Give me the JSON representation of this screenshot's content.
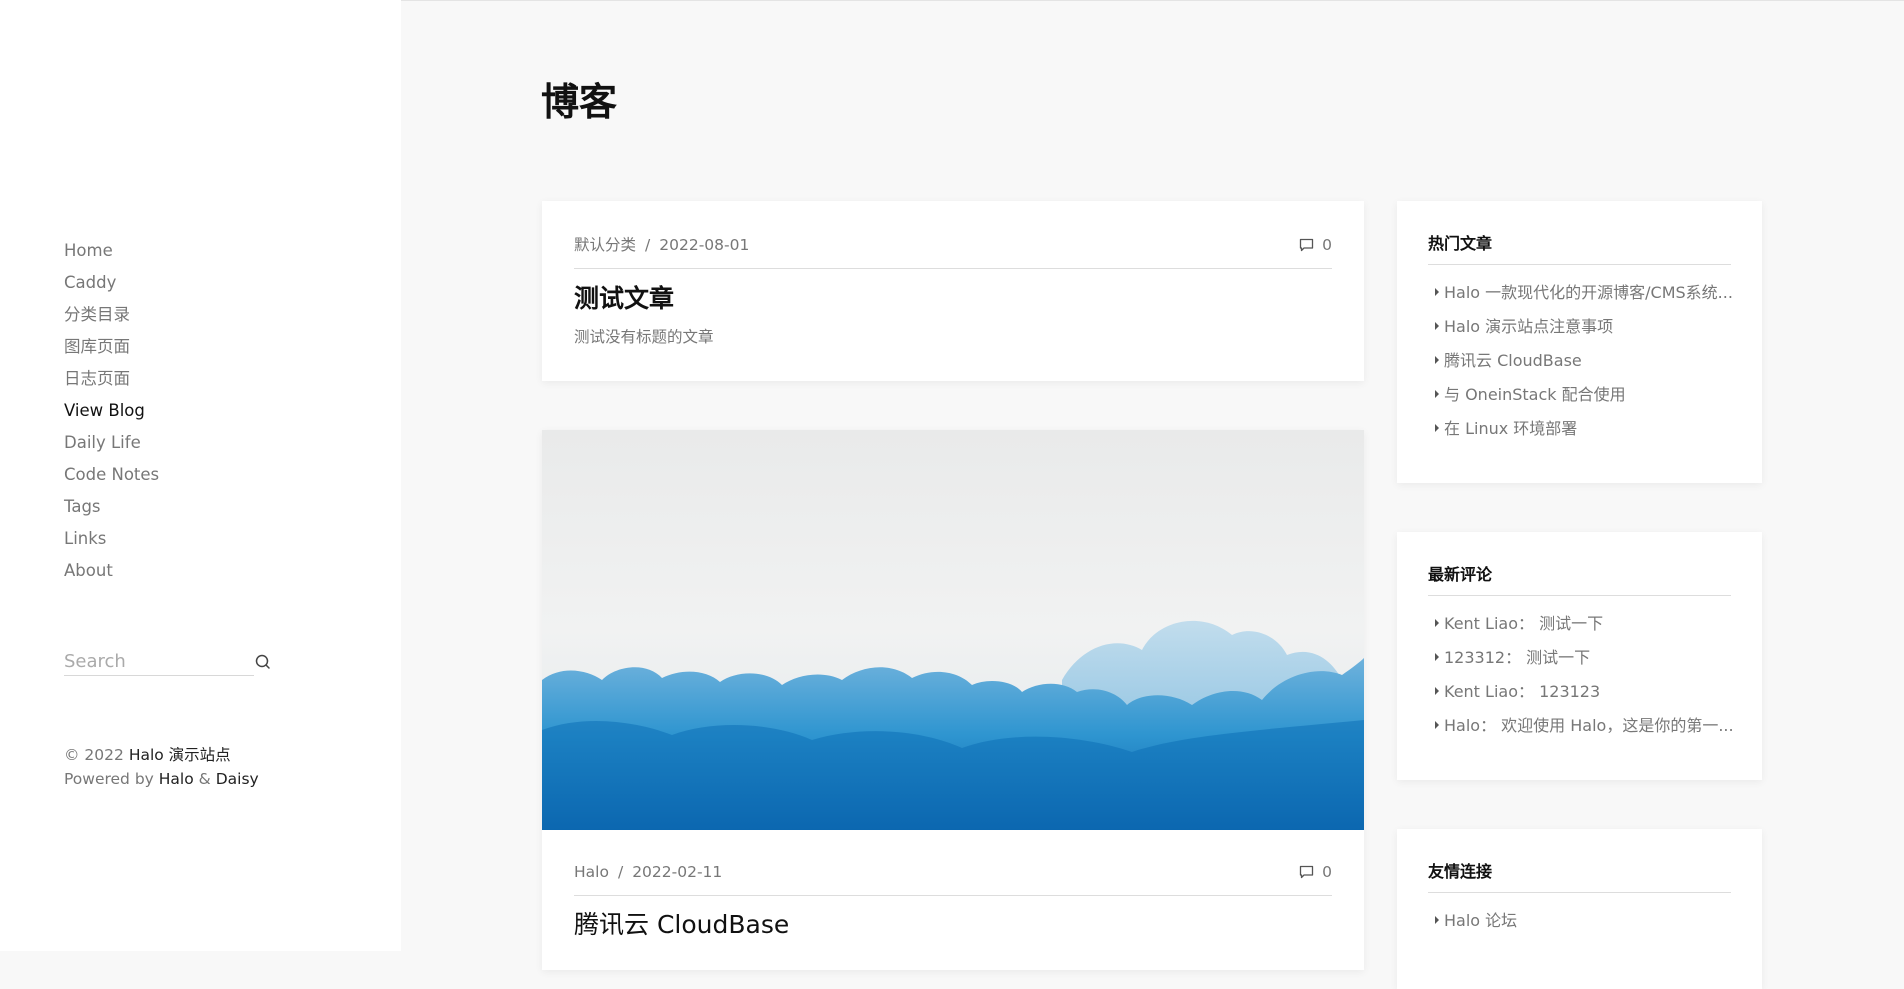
{
  "sidebar": {
    "nav": [
      "Home",
      "Caddy",
      "分类目录",
      "图库页面",
      "日志页面",
      "View Blog",
      "Daily Life",
      "Code Notes",
      "Tags",
      "Links",
      "About"
    ],
    "active_index": 5,
    "search_placeholder": "Search",
    "footer": {
      "copyright_prefix": "© 2022",
      "site_name": "Halo 演示站点",
      "powered_by": "Powered by",
      "halo": "Halo",
      "amp": "&",
      "theme": "Daisy"
    }
  },
  "main": {
    "page_title": "博客",
    "posts": [
      {
        "category": "默认分类",
        "separator": "/",
        "date": "2022-08-01",
        "comments": "0",
        "title": "测试文章",
        "excerpt": "测试没有标题的文章"
      },
      {
        "category": "Halo",
        "separator": "/",
        "date": "2022-02-11",
        "comments": "0",
        "title": "腾讯云 CloudBase",
        "has_cover": true
      }
    ]
  },
  "widgets": {
    "hot_posts": {
      "title": "热门文章",
      "items": [
        "Halo 一款现代化的开源博客/CMS系统...",
        "Halo 演示站点注意事项",
        "腾讯云 CloudBase",
        "与 OneinStack 配合使用",
        "在 Linux 环境部署"
      ]
    },
    "recent_comments": {
      "title": "最新评论",
      "items": [
        "Kent Liao： 测试一下",
        "123312： 测试一下",
        "Kent Liao： 123123",
        "Halo： 欢迎使用 Halo，这是你的第一..."
      ]
    },
    "friend_links": {
      "title": "友情连接",
      "items": [
        "Halo 论坛"
      ]
    }
  },
  "colors": {
    "background": "#f8f8f8",
    "card": "#ffffff",
    "text_muted": "#777777",
    "text_dark": "#111111"
  }
}
